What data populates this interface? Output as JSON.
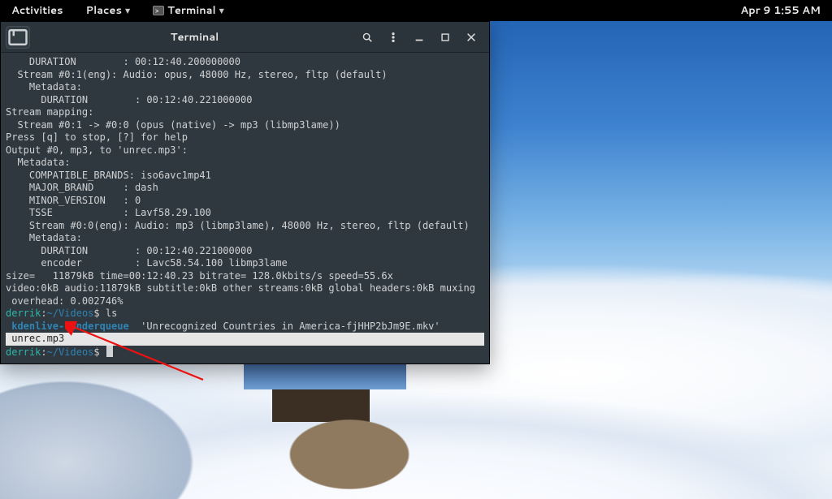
{
  "topbar": {
    "activities": "Activities",
    "places": "Places",
    "terminal": "Terminal",
    "clock": "Apr 9  1:55 AM"
  },
  "window": {
    "title": "Terminal"
  },
  "term": {
    "l01": "    DURATION        : 00:12:40.200000000",
    "l02": "  Stream #0:1(eng): Audio: opus, 48000 Hz, stereo, fltp (default)",
    "l03": "    Metadata:",
    "l04": "      DURATION        : 00:12:40.221000000",
    "l05": "Stream mapping:",
    "l06": "  Stream #0:1 -> #0:0 (opus (native) -> mp3 (libmp3lame))",
    "l07": "Press [q] to stop, [?] for help",
    "l08": "Output #0, mp3, to 'unrec.mp3':",
    "l09": "  Metadata:",
    "l10": "    COMPATIBLE_BRANDS: iso6avc1mp41",
    "l11": "    MAJOR_BRAND     : dash",
    "l12": "    MINOR_VERSION   : 0",
    "l13": "    TSSE            : Lavf58.29.100",
    "l14": "    Stream #0:0(eng): Audio: mp3 (libmp3lame), 48000 Hz, stereo, fltp (default)",
    "l15": "    Metadata:",
    "l16": "      DURATION        : 00:12:40.221000000",
    "l17": "      encoder         : Lavc58.54.100 libmp3lame",
    "l18": "size=   11879kB time=00:12:40.23 bitrate= 128.0kbits/s speed=55.6x",
    "l19": "video:0kB audio:11879kB subtitle:0kB other streams:0kB global headers:0kB muxing",
    "l20": " overhead: 0.002746%",
    "prompt_user": "derrik",
    "prompt_sep": ":",
    "prompt_path": "~/Videos",
    "prompt_dollar": "$ ",
    "cmd_ls": "ls",
    "dir_entry": " kdenlive-renderqueue",
    "file_entry1": "  'Unrecognized Countries in America-fjHHP2bJm9E.mkv'",
    "file_entry2": " unrec.mp3"
  }
}
